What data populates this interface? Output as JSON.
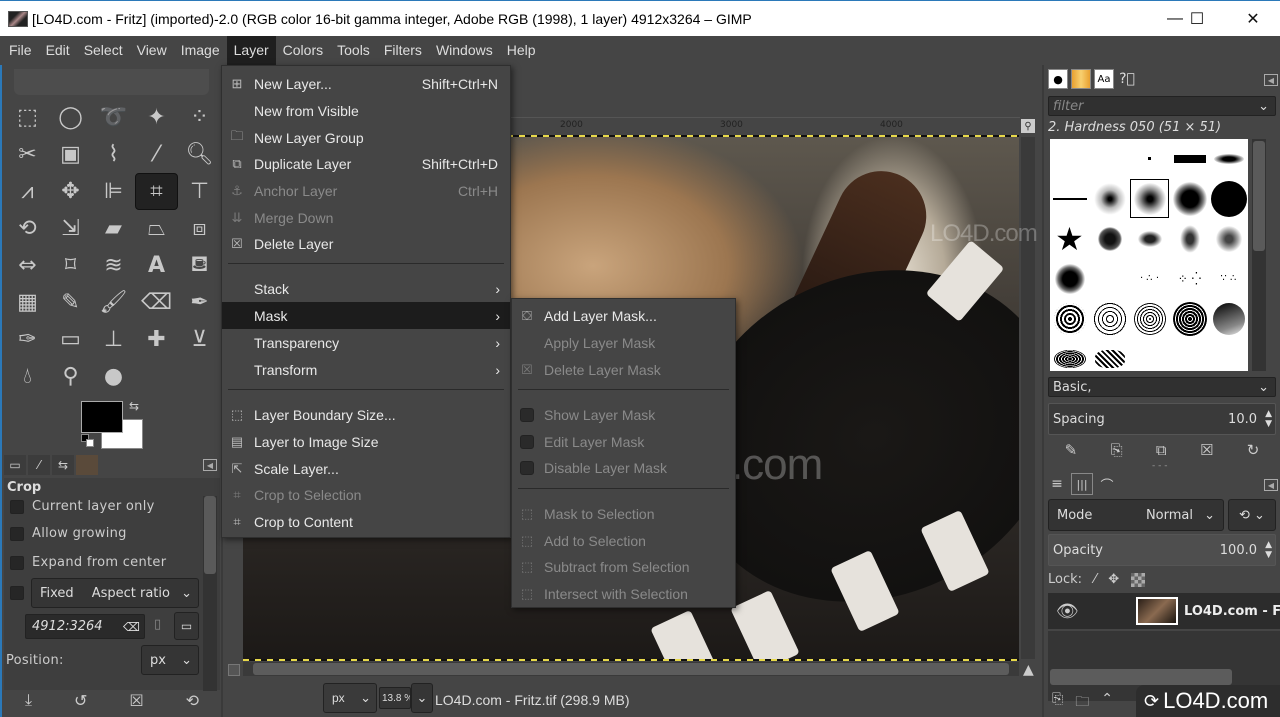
{
  "window": {
    "title": "[LO4D.com - Fritz] (imported)-2.0 (RGB color 16-bit gamma integer, Adobe RGB (1998), 1 layer) 4912x3264 – GIMP",
    "controls": {
      "minimize": "—",
      "maximize": "☐",
      "close": "✕"
    }
  },
  "menubar": {
    "items": [
      "File",
      "Edit",
      "Select",
      "View",
      "Image",
      "Layer",
      "Colors",
      "Tools",
      "Filters",
      "Windows",
      "Help"
    ],
    "active": "Layer"
  },
  "layer_menu": {
    "items": [
      {
        "label": "New Layer...",
        "shortcut": "Shift+Ctrl+N",
        "icon": "new-layer-icon",
        "enabled": true
      },
      {
        "label": "New from Visible",
        "shortcut": "",
        "icon": "",
        "enabled": true
      },
      {
        "label": "New Layer Group",
        "shortcut": "",
        "icon": "folder-icon",
        "enabled": true
      },
      {
        "label": "Duplicate Layer",
        "shortcut": "Shift+Ctrl+D",
        "icon": "duplicate-icon",
        "enabled": true
      },
      {
        "label": "Anchor Layer",
        "shortcut": "Ctrl+H",
        "icon": "anchor-icon",
        "enabled": false
      },
      {
        "label": "Merge Down",
        "shortcut": "",
        "icon": "merge-icon",
        "enabled": false
      },
      {
        "label": "Delete Layer",
        "shortcut": "",
        "icon": "delete-icon",
        "enabled": true
      },
      {
        "label": "Stack",
        "submenu": true,
        "enabled": true
      },
      {
        "label": "Mask",
        "submenu": true,
        "enabled": true,
        "highlighted": true
      },
      {
        "label": "Transparency",
        "submenu": true,
        "enabled": true
      },
      {
        "label": "Transform",
        "submenu": true,
        "enabled": true
      },
      {
        "label": "Layer Boundary Size...",
        "icon": "boundary-icon",
        "enabled": true
      },
      {
        "label": "Layer to Image Size",
        "icon": "layer-to-image-icon",
        "enabled": true
      },
      {
        "label": "Scale Layer...",
        "icon": "scale-icon",
        "enabled": true
      },
      {
        "label": "Crop to Selection",
        "icon": "crop-icon",
        "enabled": false
      },
      {
        "label": "Crop to Content",
        "icon": "crop-icon",
        "enabled": true
      }
    ]
  },
  "mask_submenu": {
    "items": [
      {
        "label": "Add Layer Mask...",
        "enabled": true,
        "type": "icon"
      },
      {
        "label": "Apply Layer Mask",
        "enabled": false,
        "type": "plain"
      },
      {
        "label": "Delete Layer Mask",
        "enabled": false,
        "type": "icon"
      },
      {
        "label": "Show Layer Mask",
        "enabled": false,
        "type": "check",
        "checked": false
      },
      {
        "label": "Edit Layer Mask",
        "enabled": false,
        "type": "check",
        "checked": false
      },
      {
        "label": "Disable Layer Mask",
        "enabled": false,
        "type": "check",
        "checked": false
      },
      {
        "label": "Mask to Selection",
        "enabled": false,
        "type": "icon"
      },
      {
        "label": "Add to Selection",
        "enabled": false,
        "type": "icon"
      },
      {
        "label": "Subtract from Selection",
        "enabled": false,
        "type": "icon"
      },
      {
        "label": "Intersect with Selection",
        "enabled": false,
        "type": "icon"
      }
    ]
  },
  "toolbox": {
    "tools": [
      "rect-select",
      "ellipse-select",
      "free-select",
      "fuzzy-select",
      "select-by-color",
      "scissors",
      "foreground-select",
      "paths",
      "color-picker",
      "zoom",
      "measure",
      "move",
      "align",
      "crop",
      "unified-transform",
      "rotate",
      "scale",
      "shear",
      "perspective",
      "3d-transform",
      "flip",
      "cage",
      "warp",
      "text",
      "bucket-fill",
      "blend",
      "pencil",
      "paintbrush",
      "eraser",
      "airbrush",
      "ink",
      "mypaint",
      "clone",
      "heal",
      "perspective-clone",
      "smudge",
      "blur",
      "dodge-burn"
    ],
    "selected": "crop",
    "fg_color": "#000000",
    "bg_color": "#ffffff"
  },
  "tool_options": {
    "title": "Crop",
    "current_layer_only": "Current layer only",
    "allow_growing": "Allow growing",
    "expand_from_center": "Expand from center",
    "fixed_label": "Fixed",
    "fixed_mode": "Aspect ratio",
    "ratio_value": "4912:3264",
    "position_label": "Position:",
    "position_unit": "px"
  },
  "canvas": {
    "ruler_ticks": [
      "2000",
      "3000",
      "4000"
    ],
    "unit": "px",
    "zoom": "13.8 %",
    "status": "LO4D.com - Fritz.tif (298.9 MB)"
  },
  "brushes": {
    "filter_placeholder": "filter",
    "current": "2. Hardness 050 (51 × 51)",
    "tag": "Basic,",
    "spacing_label": "Spacing",
    "spacing_value": "10.0"
  },
  "layers": {
    "mode_label": "Mode",
    "mode_value": "Normal",
    "opacity_label": "Opacity",
    "opacity_value": "100.0",
    "lock_label": "Lock:",
    "layer_name": "LO4D.com - F"
  },
  "watermark": "LO4D.com"
}
